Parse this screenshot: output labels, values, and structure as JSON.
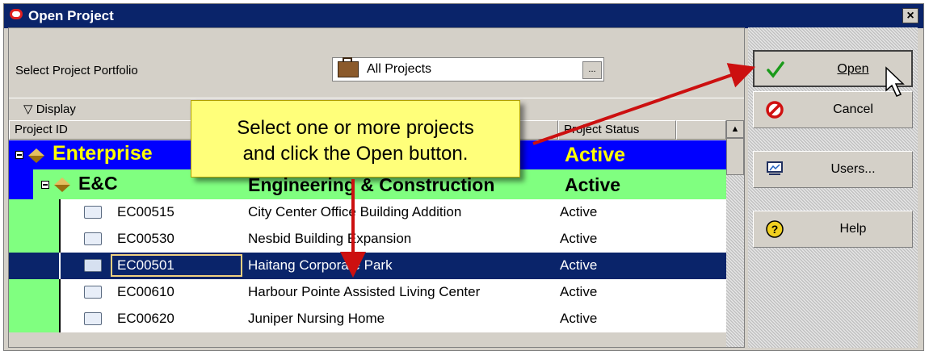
{
  "window": {
    "title": "Open Project",
    "close_glyph": "×"
  },
  "portfolio": {
    "label": "Select Project Portfolio",
    "value": "All Projects",
    "browse_label": "..."
  },
  "display": {
    "label": "▽ Display"
  },
  "columns": {
    "project_id": "Project ID",
    "project_status": "Project Status"
  },
  "callout": {
    "line1": "Select one or more projects",
    "line2": "and click the Open button."
  },
  "tree": {
    "enterprise": {
      "name": "Enterprise",
      "status": "Active"
    },
    "eac": {
      "id": "E&C",
      "name": "Engineering & Construction",
      "status": "Active"
    }
  },
  "projects": [
    {
      "id": "EC00515",
      "name": "City Center Office Building Addition",
      "status": "Active",
      "selected": false
    },
    {
      "id": "EC00530",
      "name": "Nesbid Building Expansion",
      "status": "Active",
      "selected": false
    },
    {
      "id": "EC00501",
      "name": "Haitang Corporate Park",
      "status": "Active",
      "selected": true
    },
    {
      "id": "EC00610",
      "name": "Harbour Pointe Assisted Living Center",
      "status": "Active",
      "selected": false
    },
    {
      "id": "EC00620",
      "name": "Juniper Nursing Home",
      "status": "Active",
      "selected": false
    }
  ],
  "buttons": {
    "open": "Open",
    "cancel": "Cancel",
    "users": "Users...",
    "help": "Help"
  },
  "colors": {
    "title_bar": "#0a246a",
    "enterprise_row": "#0000ff",
    "enterprise_text": "#ffff00",
    "eac_row": "#80ff80",
    "selected_row": "#0a246a",
    "callout_bg": "#ffff7a",
    "arrow": "#cc1010"
  }
}
